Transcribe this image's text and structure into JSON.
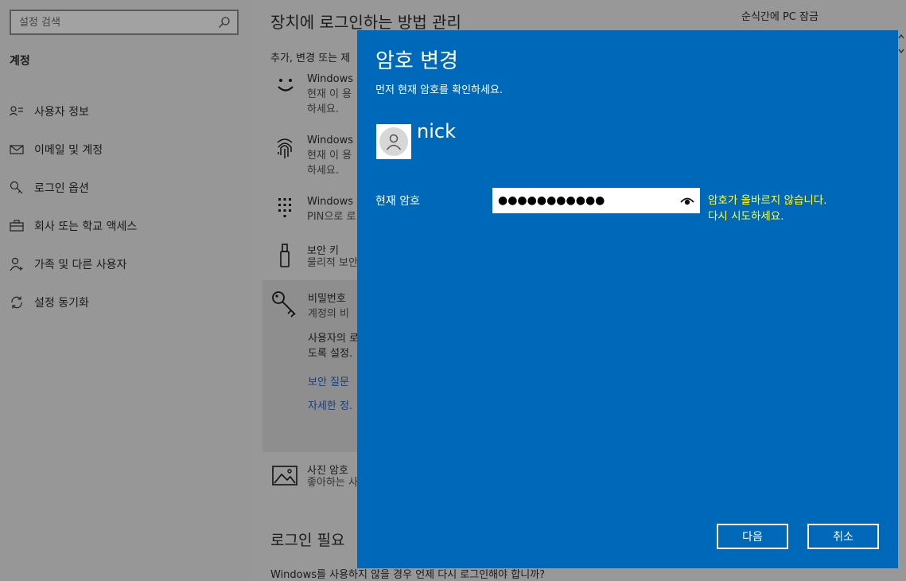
{
  "sidebar": {
    "search_placeholder": "설정 검색",
    "heading": "계정",
    "items": [
      {
        "label": "사용자 정보",
        "icon": "user-info-icon"
      },
      {
        "label": "이메일 및 계정",
        "icon": "mail-icon"
      },
      {
        "label": "로그인 옵션",
        "icon": "key-icon"
      },
      {
        "label": "회사 또는 학교 액세스",
        "icon": "briefcase-icon"
      },
      {
        "label": "가족 및 다른 사용자",
        "icon": "person-add-icon"
      },
      {
        "label": "설정 동기화",
        "icon": "sync-icon"
      }
    ]
  },
  "main": {
    "title": "장치에 로그인하는 방법 관리",
    "subtitle": "추가, 변경 또는 제",
    "lock_label": "순식간에 PC 잠금",
    "options": [
      {
        "title": "Windows",
        "desc1": "현재 이 용",
        "desc2": "하세요."
      },
      {
        "title": "Windows",
        "desc1": "현재 이 용",
        "desc2": "하세요."
      },
      {
        "title": "Windows",
        "desc1": "PIN으로 로"
      },
      {
        "title": "보안 키",
        "desc1": "물리적 보안"
      },
      {
        "title": "비밀번호",
        "desc1": "계정의 비",
        "desc2": "사용자의 로",
        "desc3": "도록 설정."
      },
      {
        "title": "사진 암호",
        "desc1": "좋아하는 사"
      }
    ],
    "links": [
      "보안 질문",
      "자세한 정."
    ],
    "section2": "로그인 필요",
    "question": "Windows를 사용하지 않을 경우 언제 다시 로그인해야 합니까?"
  },
  "dialog": {
    "title": "암호 변경",
    "subtitle": "먼저 현재 암호를 확인하세요.",
    "username": "nick",
    "field_label": "현재 암호",
    "password_value": "●●●●●●●●●●●",
    "error_line1": "암호가 올바르지 않습니다.",
    "error_line2": "다시 시도하세요.",
    "next_label": "다음",
    "cancel_label": "취소"
  },
  "colors": {
    "dialog_bg": "#0068b8",
    "error_text": "#ffff3a",
    "overlay_gray": "#989898"
  }
}
